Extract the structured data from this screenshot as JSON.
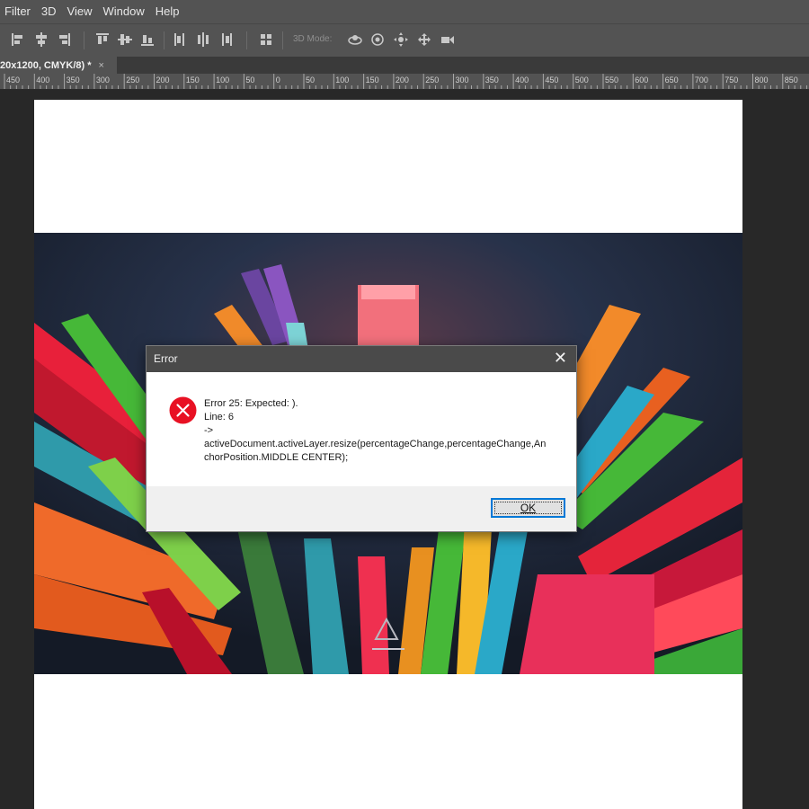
{
  "menubar": {
    "items": [
      "Filter",
      "3D",
      "View",
      "Window",
      "Help"
    ]
  },
  "toolbar": {
    "mode_label": "3D Mode:",
    "icons": [
      "align-left-icon",
      "align-center-h-icon",
      "align-right-icon",
      "align-top-icon",
      "align-center-v-icon",
      "align-bottom-icon",
      "distribute-left-icon",
      "distribute-center-icon",
      "distribute-right-icon",
      "auto-align-icon",
      "3d-orbit-icon",
      "3d-roll-icon",
      "3d-pan-icon",
      "3d-slide-icon",
      "3d-scale-icon"
    ]
  },
  "document_tab": {
    "title": "20x1200, CMYK/8) *",
    "close": "×"
  },
  "ruler": {
    "labels": [
      "450",
      "400",
      "350",
      "300",
      "250",
      "200",
      "150",
      "100",
      "50",
      "0",
      "50",
      "100",
      "150",
      "200",
      "250",
      "300",
      "350",
      "400",
      "450",
      "500",
      "550",
      "600",
      "650",
      "700",
      "750",
      "800",
      "850"
    ]
  },
  "dialog": {
    "title": "Error",
    "close_symbol": "✕",
    "message_lines": [
      "Error 25: Expected: ).",
      "Line: 6",
      "->",
      "activeDocument.activeLayer.resize(percentageChange,percentageChange,AnchorPosition.MIDDLE CENTER);"
    ],
    "ok_label": "OK",
    "icon": "error-icon"
  },
  "colors": {
    "ui_dark": "#535353",
    "canvas_bg": "#282828",
    "error_red": "#e81123",
    "focus_blue": "#0078d7"
  }
}
